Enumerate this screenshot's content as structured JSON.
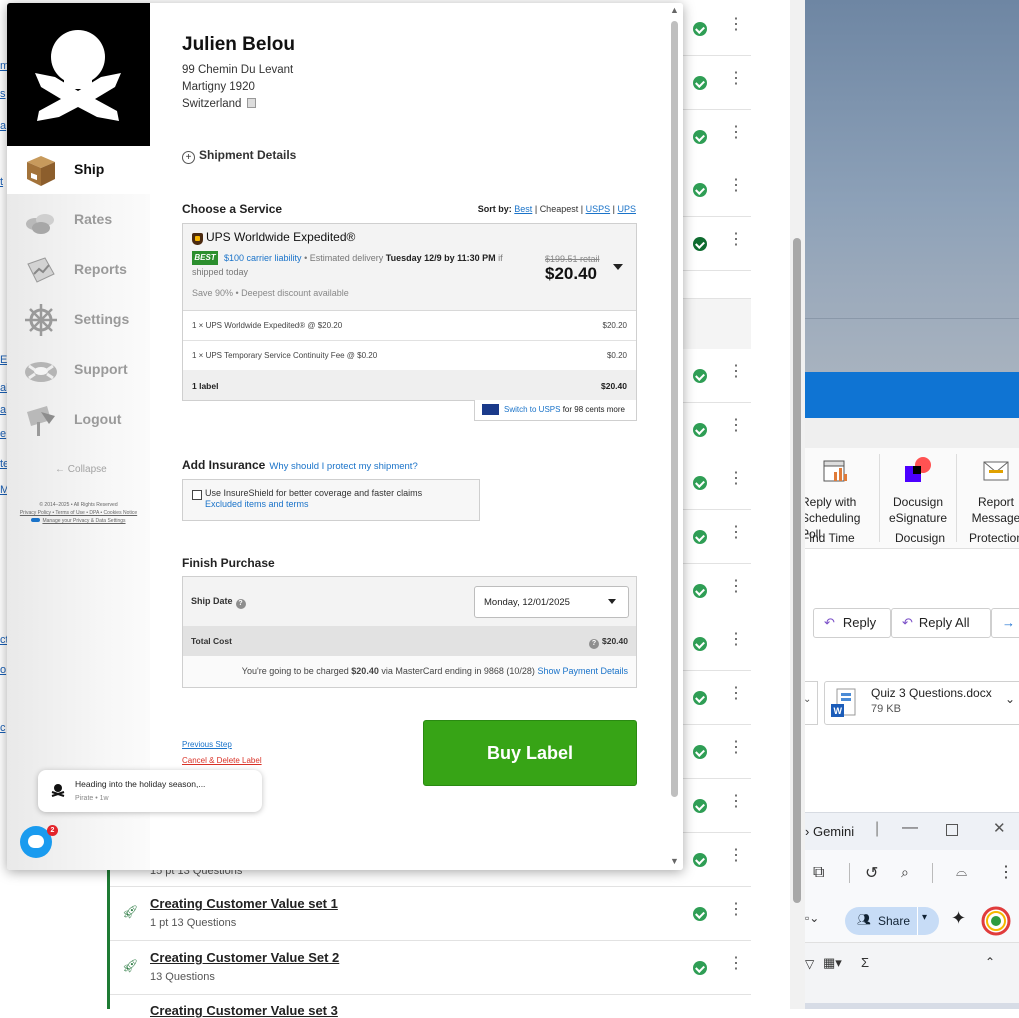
{
  "modal": {
    "address": {
      "name": "Julien Belou",
      "line1": "99 Chemin Du Levant",
      "line2": "Martigny 1920",
      "country": "Switzerland"
    },
    "shipment_details_label": "Shipment Details",
    "choose_service": {
      "title": "Choose a Service",
      "sort_by_label": "Sort by:",
      "sort_options": [
        "Best",
        "Cheapest",
        "USPS",
        "UPS"
      ],
      "sort_selected": "Cheapest",
      "separator": "|",
      "service": {
        "name": "UPS Worldwide Expedited®",
        "badge": "BEST",
        "liability": "$100 carrier liability",
        "estimated_prefix": "• Estimated delivery",
        "delivery": "Tuesday 12/9 by 11:30 PM",
        "delivery_suffix": "if shipped today",
        "savings": "Save 90% • Deepest discount available",
        "retail": "$199.51 retail",
        "price": "$20.40"
      },
      "lines": [
        {
          "label": "1 × UPS Worldwide Expedited® @ $20.20",
          "amount": "$20.20"
        },
        {
          "label": "1 × UPS Temporary Service Continuity Fee @ $0.20",
          "amount": "$0.20"
        }
      ],
      "total": {
        "label": "1 label",
        "amount": "$20.40"
      },
      "switch": {
        "link": "Switch to USPS",
        "suffix": "for 98 cents more"
      }
    },
    "insurance": {
      "title": "Add Insurance",
      "why_link": "Why should I protect my shipment?",
      "checkbox_text": "Use InsureShield for better coverage and faster claims",
      "excluded_link": "Excluded items and terms",
      "checked": false
    },
    "finish": {
      "title": "Finish Purchase",
      "ship_date_label": "Ship Date",
      "ship_date_value": "Monday, 12/01/2025",
      "total_cost_label": "Total Cost",
      "total_cost_value": "$20.40",
      "charge_prefix": "You're going to be charged",
      "charge_amount": "$20.40",
      "charge_via": "via MasterCard ending in 9868 (10/28)",
      "payment_link": "Show Payment Details"
    },
    "actions": {
      "previous_step": "Previous Step",
      "cancel_delete": "Cancel & Delete Label",
      "buy_label": "Buy Label"
    }
  },
  "sidebar": {
    "items": [
      {
        "label": "Ship",
        "icon": "box-icon",
        "active": true
      },
      {
        "label": "Rates",
        "icon": "coins-icon",
        "active": false
      },
      {
        "label": "Reports",
        "icon": "reports-icon",
        "active": false
      },
      {
        "label": "Settings",
        "icon": "ship-wheel-icon",
        "active": false
      },
      {
        "label": "Support",
        "icon": "life-ring-icon",
        "active": false
      },
      {
        "label": "Logout",
        "icon": "logout-icon",
        "active": false
      }
    ],
    "collapse_label": "Collapse",
    "legal": {
      "copyright": "© 2014–2025 • All Rights Reserved",
      "links": "Privacy Policy • Terms of Use • DPA • Cookies Notice",
      "manage": "Manage your Privacy & Data Settings"
    }
  },
  "chat": {
    "message": "Heading into the holiday season,...",
    "sender_meta": "Pirate • 1w",
    "unread_count": "2"
  },
  "background_list": {
    "rows": [
      {
        "title": "Creating Customer Value set 1",
        "sub": "1 pt    13 Questions"
      },
      {
        "title": "Creating Customer Value Set 2",
        "sub": "13 Questions"
      },
      {
        "title": "Creating Customer Value set 3",
        "sub": ""
      }
    ],
    "partial_sub": "15 pt    13 Questions"
  },
  "outlook": {
    "ribbon": {
      "reply_poll": "Reply with\nScheduling Poll",
      "docusign": "Docusign\neSignature",
      "report": "Report\nMessage",
      "group_findtime": "Find Time",
      "group_docusign": "Docusign",
      "group_protection": "Protection"
    },
    "reply": "Reply",
    "reply_all": "Reply All",
    "attachment": {
      "name": "Quiz 3 Questions.docx",
      "size": "79 KB"
    }
  },
  "gemini": {
    "title": "Gemini",
    "share": "Share",
    "sigma": "Σ"
  },
  "colors": {
    "buy_green": "#37a416",
    "link_blue": "#1a73c9",
    "best_green": "#2c8f2e",
    "outlook_blue": "#0f74d3"
  }
}
